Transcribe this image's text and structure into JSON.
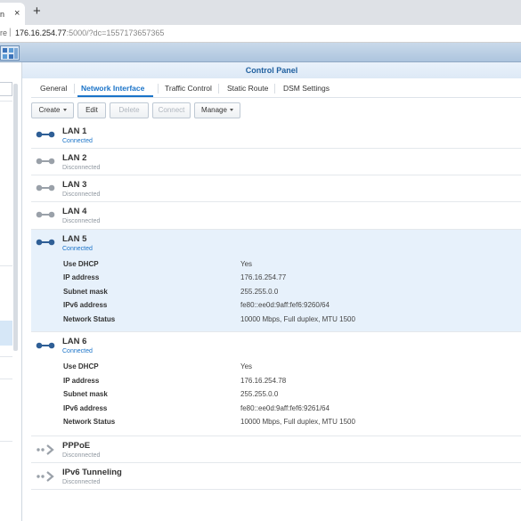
{
  "browser": {
    "tab_title": "n",
    "tab_close": "×",
    "new_tab": "+",
    "address_prefix": "re",
    "address_separator": "|",
    "address_host": "176.16.254.77",
    "address_path": ":5000/?dc=1557173657365"
  },
  "window": {
    "title": "Control Panel"
  },
  "tabs": [
    {
      "label": "General",
      "active": false
    },
    {
      "label": "Network Interface",
      "active": true
    },
    {
      "label": "Traffic Control",
      "active": false
    },
    {
      "label": "Static Route",
      "active": false
    },
    {
      "label": "DSM Settings",
      "active": false
    }
  ],
  "toolbar": {
    "create": "Create",
    "edit": "Edit",
    "delete": "Delete",
    "connect": "Connect",
    "manage": "Manage"
  },
  "detail_labels": {
    "dhcp": "Use DHCP",
    "ip": "IP address",
    "subnet": "Subnet mask",
    "ipv6": "IPv6 address",
    "network_status": "Network Status"
  },
  "interfaces": [
    {
      "name": "LAN 1",
      "status": "Connected",
      "icon": "lan-icon"
    },
    {
      "name": "LAN 2",
      "status": "Disconnected",
      "icon": "lan-icon"
    },
    {
      "name": "LAN 3",
      "status": "Disconnected",
      "icon": "lan-icon"
    },
    {
      "name": "LAN 4",
      "status": "Disconnected",
      "icon": "lan-icon"
    },
    {
      "name": "LAN 5",
      "status": "Connected",
      "icon": "lan-icon",
      "details": {
        "dhcp": "Yes",
        "ip": "176.16.254.77",
        "subnet": "255.255.0.0",
        "ipv6": "fe80::ee0d:9aff:fef6:9260/64",
        "network_status": "10000 Mbps, Full duplex, MTU 1500"
      }
    },
    {
      "name": "LAN 6",
      "status": "Connected",
      "icon": "lan-icon",
      "details": {
        "dhcp": "Yes",
        "ip": "176.16.254.78",
        "subnet": "255.255.0.0",
        "ipv6": "fe80::ee0d:9aff:fef6:9261/64",
        "network_status": "10000 Mbps, Full duplex, MTU 1500"
      }
    },
    {
      "name": "PPPoE",
      "status": "Disconnected",
      "icon": "pppoe-icon"
    },
    {
      "name": "IPv6 Tunneling",
      "status": "Disconnected",
      "icon": "tunnel-icon"
    }
  ],
  "colors": {
    "accent": "#1a73c8",
    "connected_icon": "#2f5f96",
    "disconnected_icon": "#9aa1a9",
    "selected_row": "#e7f1fb"
  }
}
